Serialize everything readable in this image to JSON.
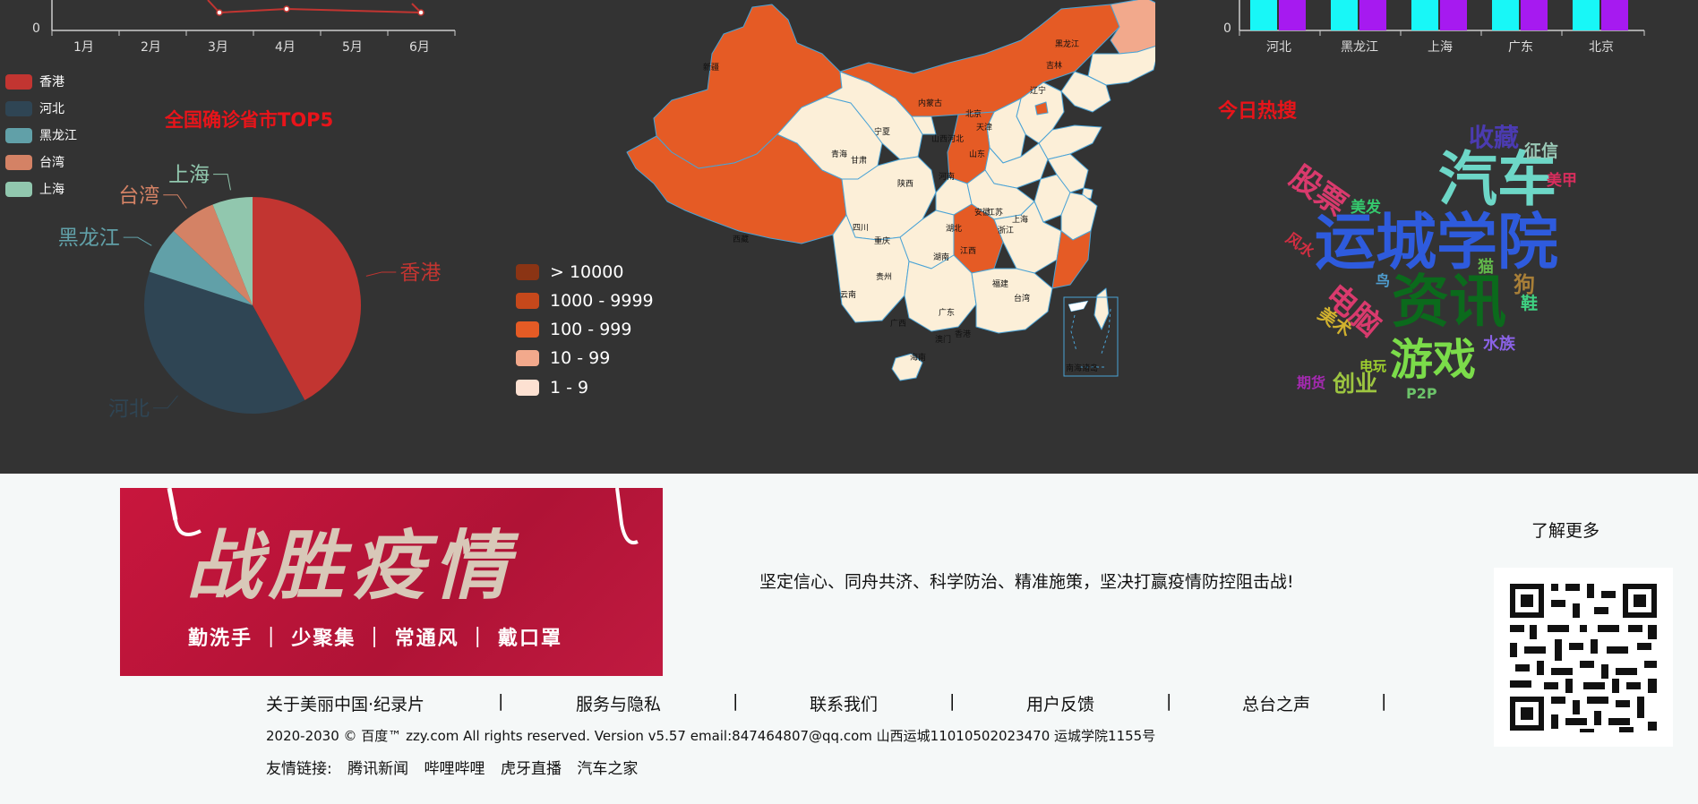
{
  "top_line_chart": {
    "y_tick_zero": "0",
    "months": [
      "1月",
      "2月",
      "3月",
      "4月",
      "5月",
      "6月"
    ]
  },
  "top_bar_chart": {
    "y_tick_zero": "0",
    "provinces": [
      "河北",
      "黑龙江",
      "上海",
      "广东",
      "北京"
    ],
    "colors": [
      "#18f7f7",
      "#a61af0"
    ]
  },
  "pie": {
    "title": "全国确诊省市TOP5",
    "legend": [
      {
        "name": "香港",
        "color": "#c23531"
      },
      {
        "name": "河北",
        "color": "#2f4554"
      },
      {
        "name": "黑龙江",
        "color": "#61a0a8"
      },
      {
        "name": "台湾",
        "color": "#d48265"
      },
      {
        "name": "上海",
        "color": "#91c7ae"
      }
    ]
  },
  "chart_data": {
    "type": "pie",
    "title": "全国确诊省市TOP5",
    "labels": [
      "香港",
      "河北",
      "黑龙江",
      "台湾",
      "上海"
    ],
    "values": [
      42,
      38,
      7,
      7,
      6
    ]
  },
  "map": {
    "legend": [
      {
        "label": "> 10000",
        "color": "#8b3414"
      },
      {
        "label": "1000 - 9999",
        "color": "#c6481b"
      },
      {
        "label": "100 - 999",
        "color": "#e55b25"
      },
      {
        "label": "10 - 99",
        "color": "#f2a98c"
      },
      {
        "label": "1 - 9",
        "color": "#fde1d2"
      }
    ],
    "province_labels": [
      "新疆",
      "西藏",
      "青海",
      "甘肃",
      "四川",
      "云南",
      "内蒙古",
      "宁夏",
      "陕西",
      "重庆",
      "贵州",
      "广西",
      "海南",
      "湖南",
      "湖北",
      "河南",
      "山西",
      "河北",
      "北京",
      "天津",
      "山东",
      "江苏",
      "安徽",
      "浙江",
      "上海",
      "江西",
      "福建",
      "广东",
      "香港",
      "澳门",
      "台湾",
      "辽宁",
      "吉林",
      "黑龙江",
      "南海诸岛"
    ],
    "colors": {
      "light": "#fcefd8",
      "orange": "#e55b25",
      "salmon": "#f2a98c",
      "border": "#4aa3d6"
    }
  },
  "hot_search": {
    "title": "今日热搜",
    "words": [
      {
        "text": "运城学院",
        "color": "#2e5bdd"
      },
      {
        "text": "资讯",
        "color": "#0b6a1c"
      },
      {
        "text": "汽车",
        "color": "#6dd7c7"
      },
      {
        "text": "游戏",
        "color": "#7bdc4a"
      },
      {
        "text": "股票",
        "color": "#d93a6d"
      },
      {
        "text": "电脑",
        "color": "#d93a6d"
      },
      {
        "text": "收藏",
        "color": "#4b3bb1"
      },
      {
        "text": "征信",
        "color": "#9ac8b6"
      },
      {
        "text": "美甲",
        "color": "#d92d5d"
      },
      {
        "text": "美发",
        "color": "#35c96e"
      },
      {
        "text": "风水",
        "color": "#d12e42"
      },
      {
        "text": "猫",
        "color": "#62b94b"
      },
      {
        "text": "狗",
        "color": "#a87f38"
      },
      {
        "text": "鸟",
        "color": "#4f9fd2"
      },
      {
        "text": "鞋",
        "color": "#3fd282"
      },
      {
        "text": "美术",
        "color": "#d1b12e"
      },
      {
        "text": "水族",
        "color": "#8a62e6"
      },
      {
        "text": "电玩",
        "color": "#9fd12e"
      },
      {
        "text": "期货",
        "color": "#a42ab0"
      },
      {
        "text": "创业",
        "color": "#9dc540"
      },
      {
        "text": "P2P",
        "color": "#6cc36a"
      }
    ]
  },
  "banner": {
    "title": "战胜疫情",
    "subtitle": "勤洗手 ｜ 少聚集 ｜ 常通风 ｜ 戴口罩"
  },
  "slogan": "坚定信心、同舟共济、科学防治、精准施策，坚决打赢疫情防控阻击战!",
  "learn_more": "了解更多",
  "footer": {
    "nav": [
      "关于美丽中国·纪录片",
      "服务与隐私",
      "联系我们",
      "用户反馈",
      "总台之声"
    ],
    "separator": "|",
    "copyright": "2020-2030 © 百度™ zzy.com All rights reserved. Version v5.57 email:847464807@qq.com 山西运城11010502023470 运城学院1155号",
    "links_label": "友情链接:",
    "links": [
      "腾讯新闻",
      "哔哩哔哩",
      "虎牙直播",
      "汽车之家"
    ]
  }
}
